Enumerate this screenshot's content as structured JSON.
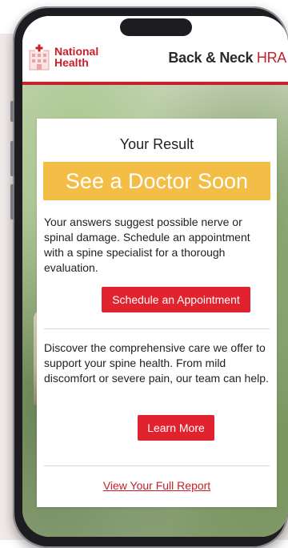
{
  "header": {
    "logo_line1": "National",
    "logo_line2": "Health",
    "title_strong": "Back & Neck ",
    "title_accent": "HRA"
  },
  "result": {
    "heading": "Your Result",
    "banner": "See a Doctor Soon",
    "message": "Your answers suggest possible nerve or spinal damage. Schedule an appointment with a spine specialist for a thorough evaluation.",
    "schedule_button": "Schedule an Appointment",
    "care_message": "Discover the comprehensive care we offer to support your spine health. From mild discomfort or severe pain, our team can help.",
    "learn_more_button": "Learn More",
    "report_link": "View Your Full Report"
  },
  "colors": {
    "brand_red": "#c8202a",
    "button_red": "#e0232e",
    "banner_yellow": "#f4bd45"
  },
  "icons": {
    "logo": "medical-cross-building-icon"
  }
}
